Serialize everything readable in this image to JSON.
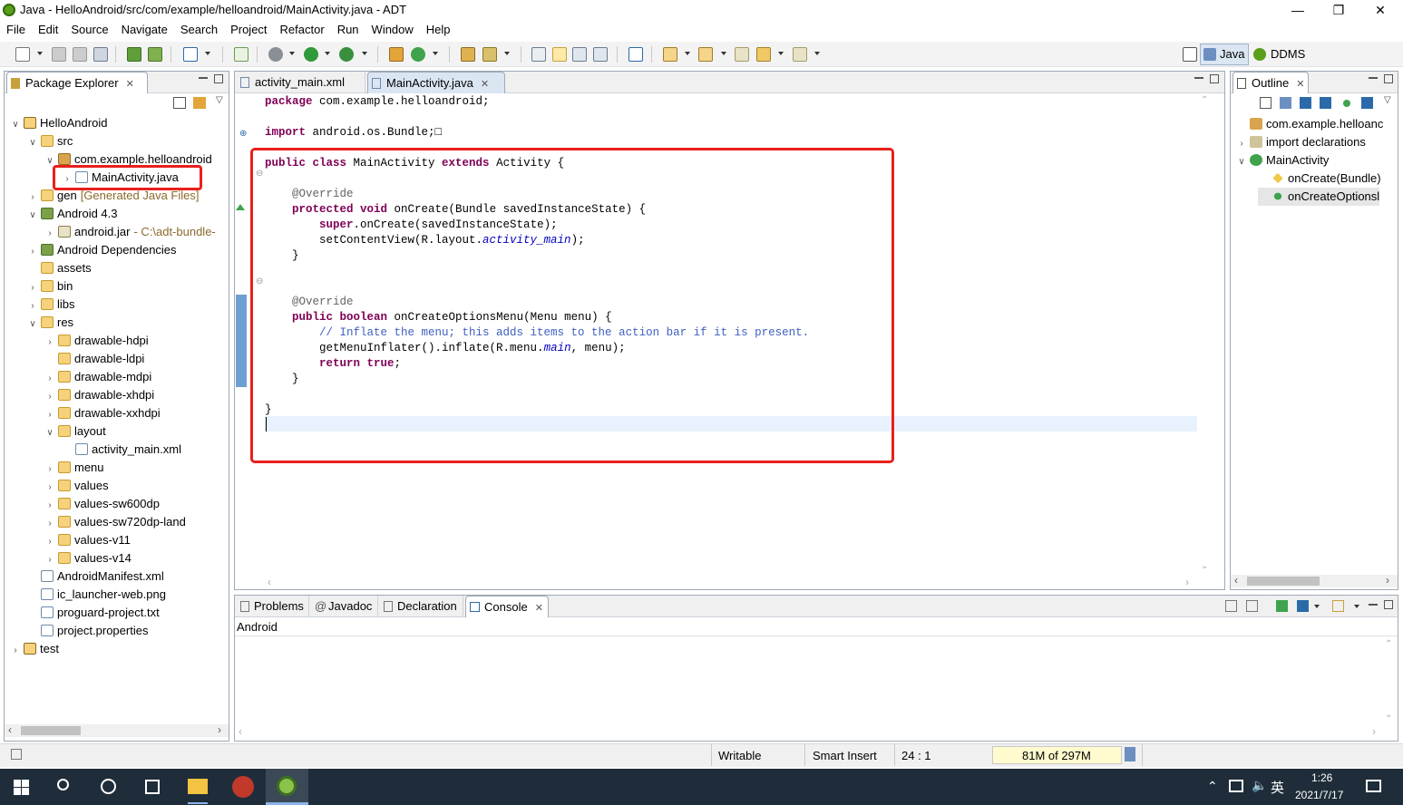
{
  "window": {
    "title": "Java - HelloAndroid/src/com/example/helloandroid/MainActivity.java - ADT",
    "minimize": "—",
    "restore": "❐",
    "close": "✕"
  },
  "menubar": [
    "File",
    "Edit",
    "Source",
    "Navigate",
    "Search",
    "Project",
    "Refactor",
    "Run",
    "Window",
    "Help"
  ],
  "perspectives": {
    "java": "Java",
    "ddms": "DDMS"
  },
  "package_explorer": {
    "title": "Package Explorer",
    "tree": [
      {
        "label": "HelloAndroid",
        "suffix": "",
        "twisty": "∨",
        "icon": "proj"
      },
      {
        "label": "src",
        "suffix": "",
        "twisty": "∨",
        "icon": "folder"
      },
      {
        "label": "com.example.helloandroid",
        "suffix": "",
        "twisty": "∨",
        "icon": "pkg"
      },
      {
        "label": "MainActivity.java",
        "suffix": "",
        "twisty": "›",
        "icon": "file"
      },
      {
        "label": "gen",
        "suffix": "[Generated Java Files]",
        "twisty": "›",
        "icon": "folder"
      },
      {
        "label": "Android 4.3",
        "suffix": "",
        "twisty": "∨",
        "icon": "lib"
      },
      {
        "label": "android.jar",
        "suffix": "- C:\\adt-bundle-",
        "twisty": "›",
        "icon": "jar"
      },
      {
        "label": "Android Dependencies",
        "suffix": "",
        "twisty": "›",
        "icon": "lib"
      },
      {
        "label": "assets",
        "suffix": "",
        "twisty": "",
        "icon": "folder"
      },
      {
        "label": "bin",
        "suffix": "",
        "twisty": "›",
        "icon": "folder"
      },
      {
        "label": "libs",
        "suffix": "",
        "twisty": "›",
        "icon": "folder"
      },
      {
        "label": "res",
        "suffix": "",
        "twisty": "∨",
        "icon": "folder"
      },
      {
        "label": "drawable-hdpi",
        "suffix": "",
        "twisty": "›",
        "icon": "folder"
      },
      {
        "label": "drawable-ldpi",
        "suffix": "",
        "twisty": "",
        "icon": "folder"
      },
      {
        "label": "drawable-mdpi",
        "suffix": "",
        "twisty": "›",
        "icon": "folder"
      },
      {
        "label": "drawable-xhdpi",
        "suffix": "",
        "twisty": "›",
        "icon": "folder"
      },
      {
        "label": "drawable-xxhdpi",
        "suffix": "",
        "twisty": "›",
        "icon": "folder"
      },
      {
        "label": "layout",
        "suffix": "",
        "twisty": "∨",
        "icon": "folder"
      },
      {
        "label": "activity_main.xml",
        "suffix": "",
        "twisty": "",
        "icon": "file"
      },
      {
        "label": "menu",
        "suffix": "",
        "twisty": "›",
        "icon": "folder"
      },
      {
        "label": "values",
        "suffix": "",
        "twisty": "›",
        "icon": "folder"
      },
      {
        "label": "values-sw600dp",
        "suffix": "",
        "twisty": "›",
        "icon": "folder"
      },
      {
        "label": "values-sw720dp-land",
        "suffix": "",
        "twisty": "›",
        "icon": "folder"
      },
      {
        "label": "values-v11",
        "suffix": "",
        "twisty": "›",
        "icon": "folder"
      },
      {
        "label": "values-v14",
        "suffix": "",
        "twisty": "›",
        "icon": "folder"
      },
      {
        "label": "AndroidManifest.xml",
        "suffix": "",
        "twisty": "",
        "icon": "file"
      },
      {
        "label": "ic_launcher-web.png",
        "suffix": "",
        "twisty": "",
        "icon": "file"
      },
      {
        "label": "proguard-project.txt",
        "suffix": "",
        "twisty": "",
        "icon": "file"
      },
      {
        "label": "project.properties",
        "suffix": "",
        "twisty": "",
        "icon": "file"
      },
      {
        "label": "test",
        "suffix": "",
        "twisty": "›",
        "icon": "proj"
      }
    ]
  },
  "editor": {
    "tabs": [
      {
        "label": "activity_main.xml"
      },
      {
        "label": "MainActivity.java"
      }
    ],
    "lines": [
      [
        {
          "t": "package",
          "c": "kw"
        },
        {
          "t": " com.example.helloandroid;",
          "c": ""
        }
      ],
      [],
      [
        {
          "t": "import",
          "c": "kw"
        },
        {
          "t": " android.os.Bundle;",
          "c": ""
        },
        {
          "t": "□",
          "c": ""
        }
      ],
      [],
      [
        {
          "t": "public class",
          "c": "kw"
        },
        {
          "t": " MainActivity ",
          "c": ""
        },
        {
          "t": "extends",
          "c": "kw"
        },
        {
          "t": " Activity {",
          "c": ""
        }
      ],
      [],
      [
        {
          "t": "    @Override",
          "c": "an"
        }
      ],
      [
        {
          "t": "    ",
          "c": ""
        },
        {
          "t": "protected void",
          "c": "kw"
        },
        {
          "t": " onCreate(Bundle savedInstanceState) {",
          "c": ""
        }
      ],
      [
        {
          "t": "        ",
          "c": ""
        },
        {
          "t": "super",
          "c": "kw"
        },
        {
          "t": ".onCreate(savedInstanceState);",
          "c": ""
        }
      ],
      [
        {
          "t": "        setContentView(R.layout.",
          "c": ""
        },
        {
          "t": "activity_main",
          "c": "fi"
        },
        {
          "t": ");",
          "c": ""
        }
      ],
      [
        {
          "t": "    }",
          "c": ""
        }
      ],
      [],
      [],
      [
        {
          "t": "    @Override",
          "c": "an"
        }
      ],
      [
        {
          "t": "    ",
          "c": ""
        },
        {
          "t": "public boolean",
          "c": "kw"
        },
        {
          "t": " onCreateOptionsMenu(Menu menu) {",
          "c": ""
        }
      ],
      [
        {
          "t": "        // Inflate the menu; this adds items to the action bar if it is present.",
          "c": "cm"
        }
      ],
      [
        {
          "t": "        getMenuInflater().inflate(R.menu.",
          "c": ""
        },
        {
          "t": "main",
          "c": "fi"
        },
        {
          "t": ", menu);",
          "c": ""
        }
      ],
      [
        {
          "t": "        ",
          "c": ""
        },
        {
          "t": "return true",
          "c": "kw"
        },
        {
          "t": ";",
          "c": ""
        }
      ],
      [
        {
          "t": "    }",
          "c": ""
        }
      ],
      [],
      [
        {
          "t": "}",
          "c": ""
        }
      ],
      []
    ]
  },
  "outline": {
    "title": "Outline",
    "items": [
      {
        "label": "com.example.helloanc",
        "twisty": ""
      },
      {
        "label": "import declarations",
        "twisty": "›"
      },
      {
        "label": "MainActivity",
        "twisty": "∨"
      },
      {
        "label": "onCreate(Bundle)",
        "twisty": ""
      },
      {
        "label": "onCreateOptionsl",
        "twisty": ""
      }
    ]
  },
  "bottom": {
    "tabs": [
      "Problems",
      "Javadoc",
      "Declaration",
      "Console"
    ],
    "console_label": "Android"
  },
  "status": {
    "writable": "Writable",
    "insert": "Smart Insert",
    "position": "24 : 1",
    "memory": "81M of 297M"
  },
  "taskbar": {
    "ime": "英",
    "time": "1:26",
    "date": "2021/7/17"
  },
  "colors": {
    "highlight_box": "#e8201c",
    "current_line": "#e8f2fe"
  }
}
